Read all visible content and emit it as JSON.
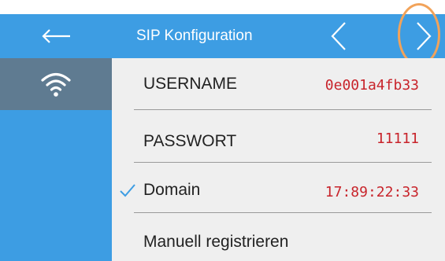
{
  "header": {
    "title": "SIP Konfiguration",
    "back_icon": "arrow-left-icon",
    "prev_icon": "chevron-left-icon",
    "next_icon": "chevron-right-icon"
  },
  "sidebar": {
    "items": [
      {
        "icon": "wifi-icon",
        "selected": true
      }
    ]
  },
  "settings": {
    "rows": [
      {
        "label": "USERNAME",
        "value": "0e001a4fb33"
      },
      {
        "label": "PASSWORT",
        "value": "11111"
      },
      {
        "label": "Domain",
        "value": "17:89:22:33",
        "checked": true
      },
      {
        "label": "Manuell registrieren"
      }
    ]
  },
  "colors": {
    "accent_blue": "#3d9de3",
    "sidebar_selected": "#5f7b91",
    "value_red": "#c8242b",
    "highlight_orange": "#f2a35a",
    "content_background": "#efefef"
  }
}
